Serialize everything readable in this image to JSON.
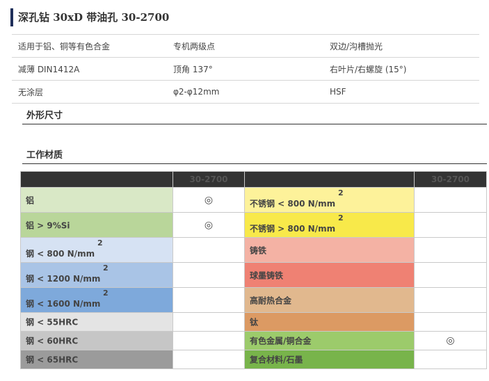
{
  "title": "深孔钻 30xD 带油孔 30-2700",
  "specs": [
    [
      "适用于铝、铜等有色合金",
      "专机两级点",
      "双边/沟槽抛光"
    ],
    [
      "减薄 DIN1412A",
      "顶角 137°",
      "右叶片/右螺旋 (15°)"
    ],
    [
      "无涂层",
      "φ2-φ12mm",
      "HSF"
    ]
  ],
  "sections": {
    "dims": "外形尺寸",
    "materials": "工作材质"
  },
  "materials": {
    "col_header": "30-2700",
    "mark_symbol": "◎",
    "left": [
      {
        "name": "铝",
        "sup": "",
        "color": "#d9e8c6",
        "mark": "◎"
      },
      {
        "name": "铝 > 9%Si",
        "sup": "",
        "color": "#b9d69a",
        "mark": "◎"
      },
      {
        "name": "钢 < 800 N/mm",
        "sup": "2",
        "color": "#d6e2f3",
        "mark": ""
      },
      {
        "name": "钢 < 1200 N/mm",
        "sup": "2",
        "color": "#a9c4e6",
        "mark": ""
      },
      {
        "name": "钢 < 1600 N/mm",
        "sup": "2",
        "color": "#7ea9db",
        "mark": ""
      },
      {
        "name": "钢 < 55HRC",
        "sup": "",
        "color": "#e4e4e4",
        "mark": ""
      },
      {
        "name": "钢 < 60HRC",
        "sup": "",
        "color": "#c6c6c6",
        "mark": ""
      },
      {
        "name": "钢 < 65HRC",
        "sup": "",
        "color": "#9b9b9b",
        "mark": ""
      }
    ],
    "right": [
      {
        "name": "不锈钢 < 800 N/mm",
        "sup": "2",
        "color": "#fdf29a",
        "mark": ""
      },
      {
        "name": "不锈钢 > 800 N/mm",
        "sup": "2",
        "color": "#f8e94a",
        "mark": ""
      },
      {
        "name": "铸铁",
        "sup": "",
        "color": "#f4b2a4",
        "mark": ""
      },
      {
        "name": "球墨铸铁",
        "sup": "",
        "color": "#ef8173",
        "mark": ""
      },
      {
        "name": "高耐热合金",
        "sup": "",
        "color": "#e1b88e",
        "mark": ""
      },
      {
        "name": "钛",
        "sup": "",
        "color": "#dc9a63",
        "mark": ""
      },
      {
        "name": "有色金属/铜合金",
        "sup": "",
        "color": "#9ccb6b",
        "mark": "◎"
      },
      {
        "name": "复合材料/石墨",
        "sup": "",
        "color": "#78b44b",
        "mark": ""
      }
    ]
  }
}
